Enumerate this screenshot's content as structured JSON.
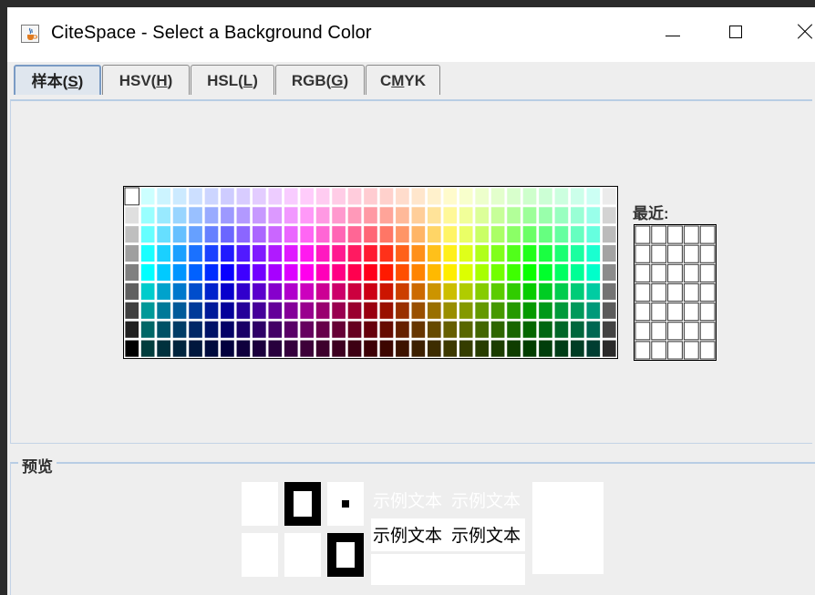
{
  "window": {
    "title": "CiteSpace - Select a Background Color",
    "app_icon": "java-coffee-icon",
    "controls": [
      "minimize-icon",
      "maximize-icon",
      "close-icon"
    ]
  },
  "tabs": [
    {
      "label_main": "样本(",
      "mnemonic": "S",
      "label_end": ")",
      "active": true
    },
    {
      "label_main": "HSV(",
      "mnemonic": "H",
      "label_end": ")",
      "active": false
    },
    {
      "label_main": "HSL(",
      "mnemonic": "L",
      "label_end": ")",
      "active": false
    },
    {
      "label_main": "RGB(",
      "mnemonic": "G",
      "label_end": ")",
      "active": false
    },
    {
      "label_pre": "C",
      "mnemonic": "M",
      "label_post": "YK",
      "active": false
    }
  ],
  "swatches": {
    "columns": 31,
    "rows": 9,
    "selected": {
      "row": 0,
      "col": 0
    }
  },
  "recent": {
    "label": "最近:",
    "columns": 5,
    "rows": 7
  },
  "preview": {
    "label": "预览",
    "sample_text": "示例文本",
    "sample_text_light_color": "#ffffff",
    "sample_text_dark_color": "#000000"
  },
  "colors": {
    "window_bg": "#eeeeee",
    "active_tab_border": "#7a9bc4",
    "swatch_border": "#000000"
  }
}
